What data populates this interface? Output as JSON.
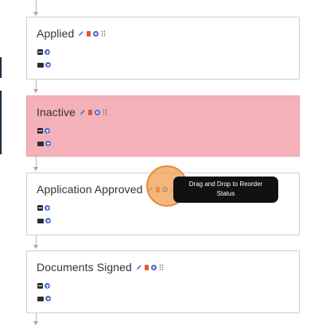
{
  "statuses": [
    {
      "title": "Applied",
      "tone": "normal"
    },
    {
      "title": "Inactive",
      "tone": "inactive"
    },
    {
      "title": "Application Approved",
      "tone": "normal"
    },
    {
      "title": "Documents Signed",
      "tone": "normal"
    }
  ],
  "tooltip": {
    "line1": "Drag and Drop to Reorder",
    "line2": "Status"
  },
  "icons": {
    "edit": "pencil-icon",
    "delete": "trash-icon",
    "settings": "gear-icon",
    "reorder": "drag-handle-icon",
    "document": "document-icon",
    "email": "email-icon",
    "add": "add-icon"
  },
  "colors": {
    "inactive_bg": "#f5b1b9",
    "accent_blue": "#4a6bd8",
    "delete_red": "#e8552f",
    "highlight_orange": "#f29e50",
    "tooltip_bg": "#111111"
  }
}
